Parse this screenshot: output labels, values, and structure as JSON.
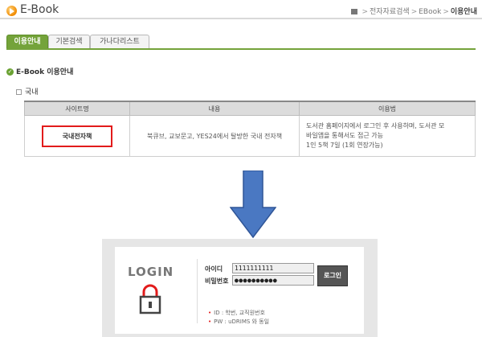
{
  "header": {
    "title": "E-Book",
    "breadcrumb": [
      "전자자료검색",
      "EBook",
      "이용안내"
    ]
  },
  "tabs": [
    {
      "label": "이용안내",
      "active": true
    },
    {
      "label": "기본검색",
      "active": false
    },
    {
      "label": "가나다리스트",
      "active": false
    }
  ],
  "section": {
    "title": "E-Book 이용안내",
    "subtitle": "국내"
  },
  "table": {
    "headers": [
      "사이트명",
      "내용",
      "이용법"
    ],
    "rows": [
      {
        "site": "국내전자책",
        "content": "북큐브, 교보문고, YES24에서 탈방한 국내 전자책",
        "usage": [
          "도서관 홈페이지에서 로그인 후 사용하며, 도서관 모",
          "바일앱을 통해서도 접근 가능",
          "1인 5책 7일 (1회 연장가능)"
        ]
      }
    ]
  },
  "login": {
    "title": "LOGIN",
    "id_label": "아이디",
    "pw_label": "비밀번호",
    "id_value": "1111111111",
    "pw_value": "●●●●●●●●●●",
    "button_label": "로그인",
    "notes": [
      "ID : 학번, 교직원번호",
      "PW : uDRIMS 와 동일"
    ]
  },
  "colors": {
    "accent_green": "#74a33a",
    "highlight_red": "#e21b1b",
    "arrow_blue": "#4a78c2"
  }
}
